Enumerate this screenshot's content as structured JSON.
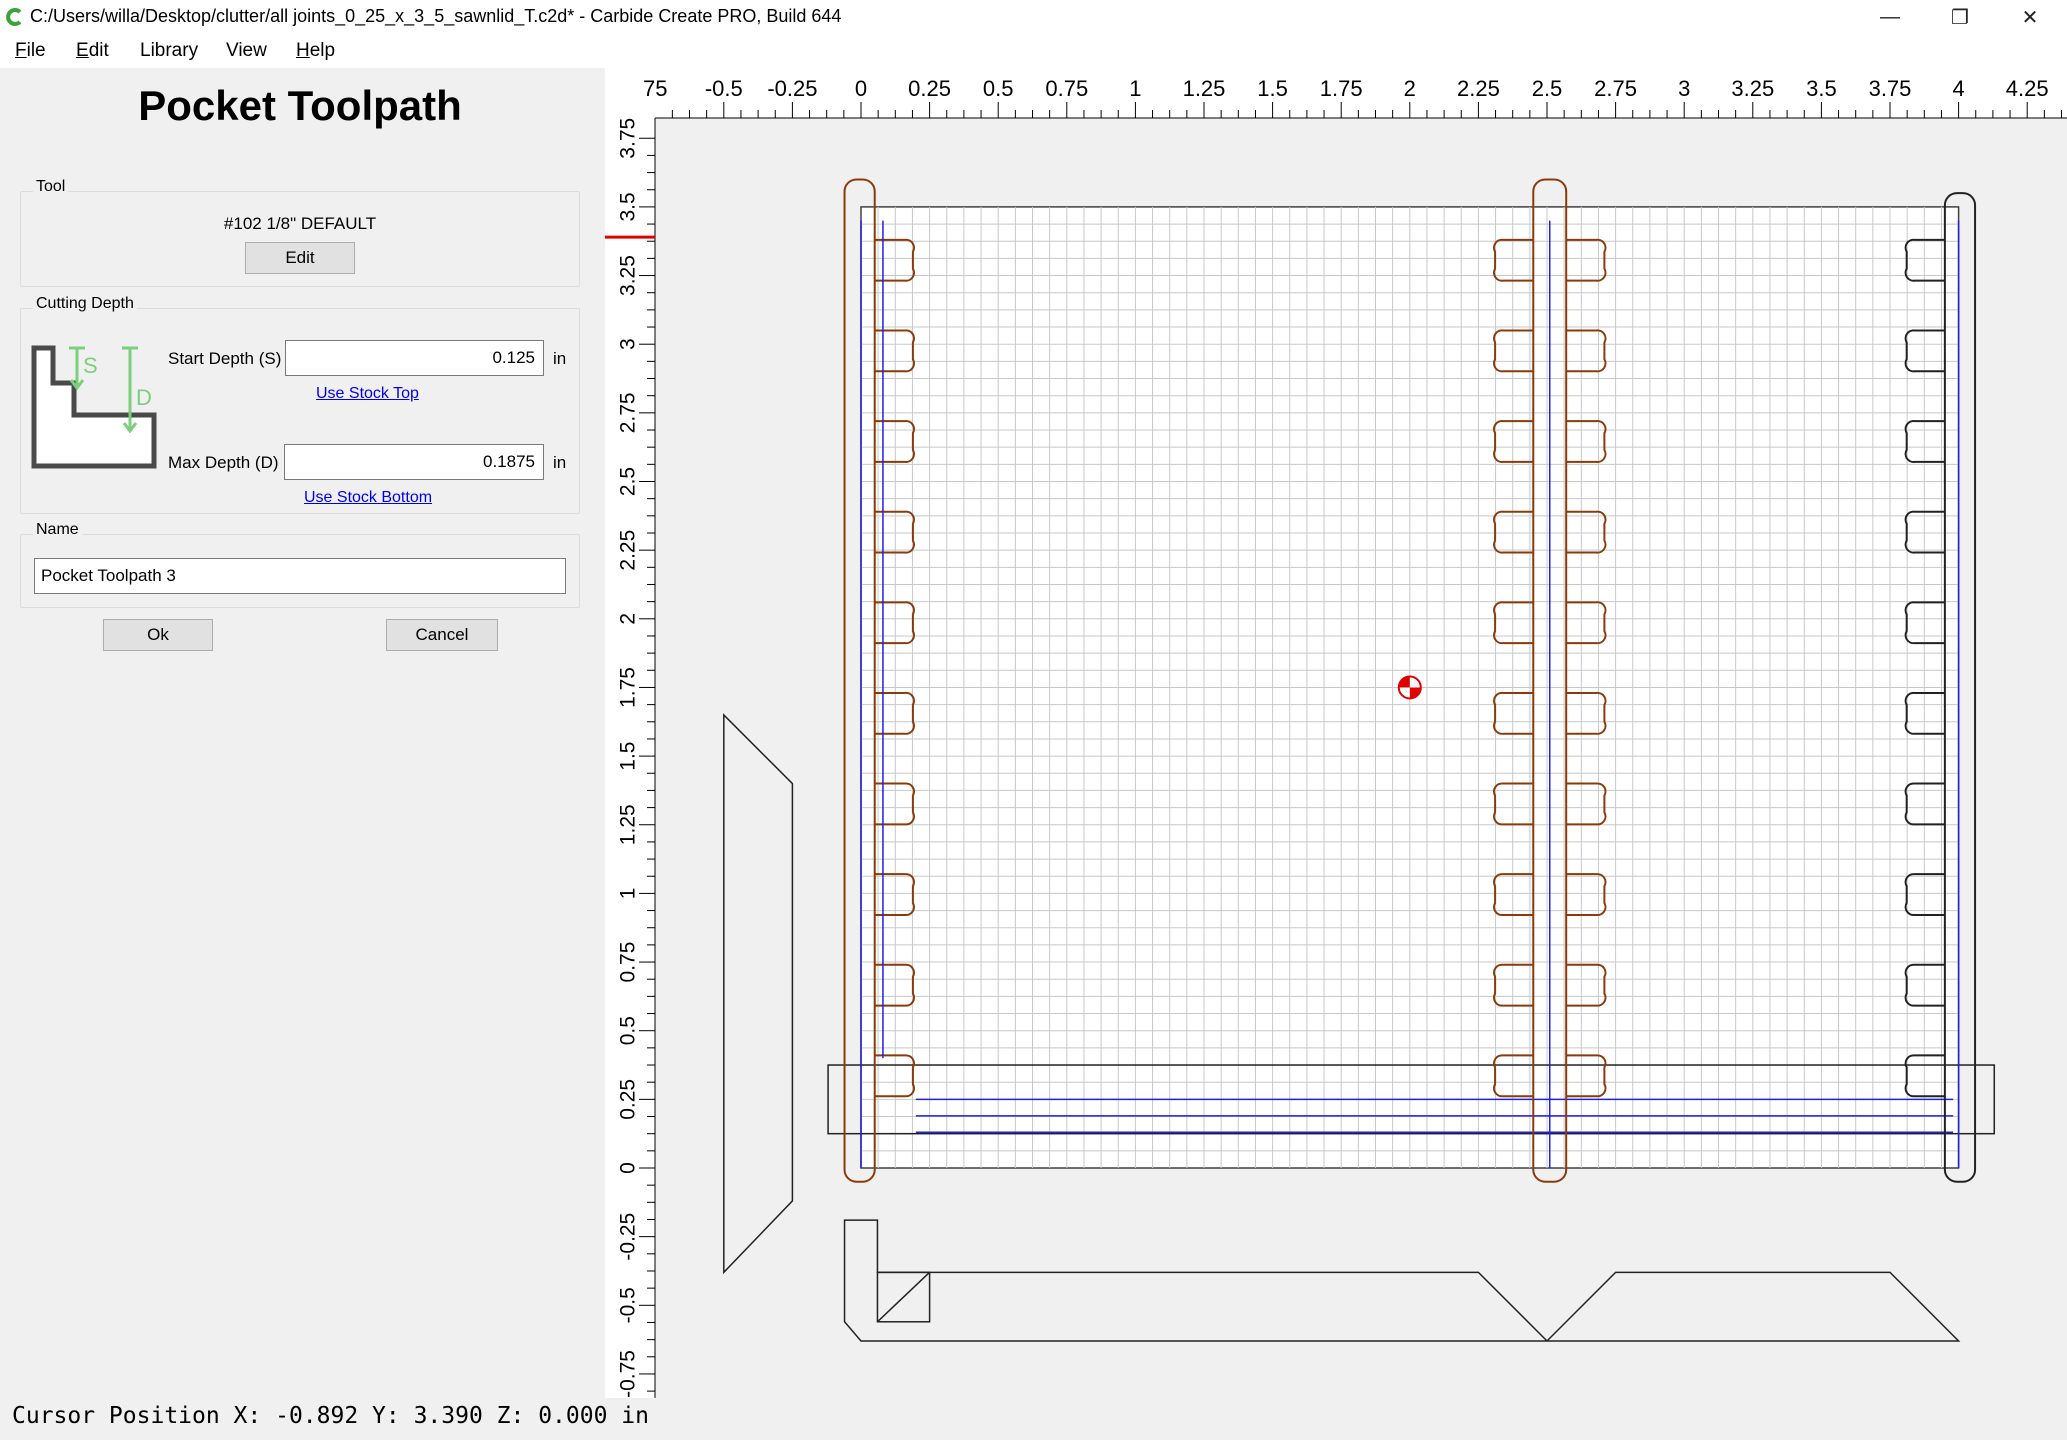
{
  "window": {
    "title": "C:/Users/willa/Desktop/clutter/all joints_0_25_x_3_5_sawnlid_T.c2d* - Carbide Create PRO, Build 644",
    "minimize_glyph": "—",
    "maximize_glyph": "❐",
    "close_glyph": "✕"
  },
  "menu": [
    {
      "accel": "F",
      "rest": "ile"
    },
    {
      "accel": "E",
      "rest": "dit"
    },
    {
      "accel": "",
      "rest": "Library"
    },
    {
      "accel": "",
      "rest": "View"
    },
    {
      "accel": "H",
      "rest": "elp"
    }
  ],
  "panel": {
    "title": "Pocket Toolpath",
    "tool": {
      "group_label": "Tool",
      "name": "#102 1/8\" DEFAULT",
      "edit_label": "Edit"
    },
    "cutting_depth": {
      "group_label": "Cutting Depth",
      "diagram_s": "S",
      "diagram_d": "D",
      "start_label": "Start Depth (S)",
      "start_value": "0.125",
      "start_unit": "in",
      "use_stock_top": "Use Stock Top",
      "max_label": "Max Depth (D)",
      "max_value": "0.1875",
      "max_unit": "in",
      "use_stock_bottom": "Use Stock Bottom"
    },
    "name_group": {
      "group_label": "Name",
      "value": "Pocket Toolpath 3"
    },
    "ok_label": "Ok",
    "cancel_label": "Cancel"
  },
  "canvas": {
    "x_ruler_labels": [
      "75",
      "-0.5",
      "-0.25",
      "0",
      "0.25",
      "0.5",
      "0.75",
      "1",
      "1.25",
      "1.5",
      "1.75",
      "2",
      "2.25",
      "2.5",
      "2.75",
      "3",
      "3.25",
      "3.5",
      "3.75",
      "4",
      "4.25"
    ],
    "y_ruler_labels": [
      "3.75",
      "3.5",
      "3.25",
      "3",
      "2.75",
      "2.5",
      "2.25",
      "2",
      "1.75",
      "1.5",
      "1.25",
      "1",
      "0.75",
      "0.5",
      "0.25",
      "0",
      "-0.25",
      "-0.5",
      "-0.75"
    ],
    "colors": {
      "grid": "#c8c8c8",
      "stock_outline": "#404040",
      "selected_path": "#8b3a0a",
      "toolpath": "#2020e0",
      "marker": "#e00000",
      "background": "#ffffff"
    }
  },
  "status": {
    "text": "Cursor Position X: -0.892 Y: 3.390 Z: 0.000 in"
  }
}
